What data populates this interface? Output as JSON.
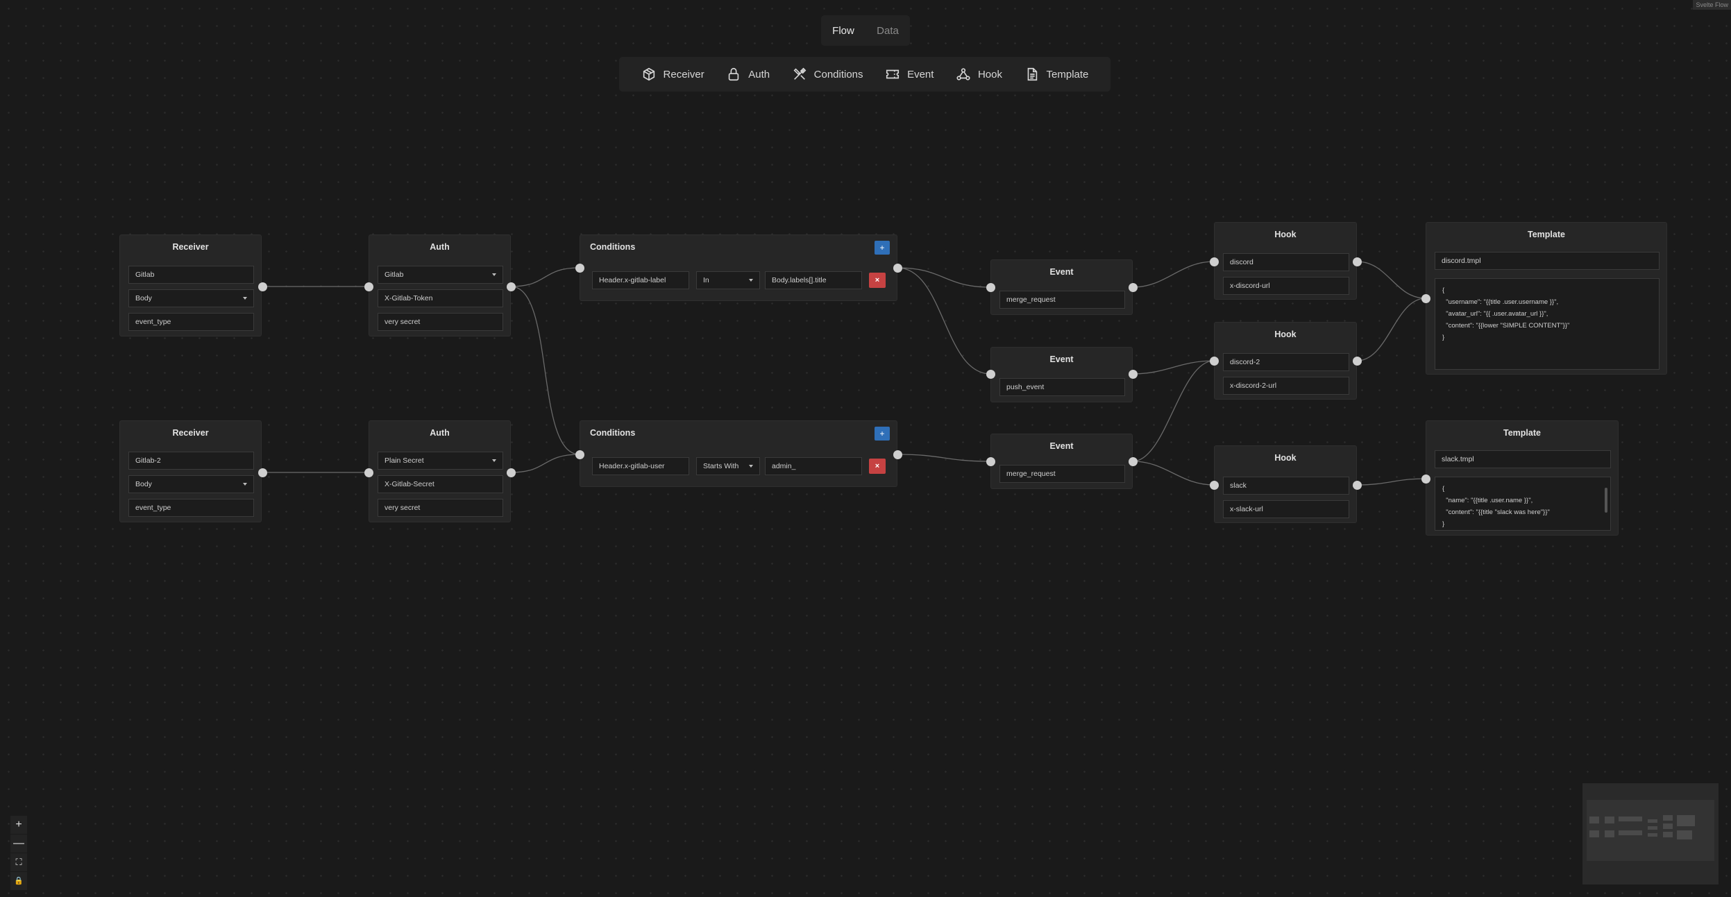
{
  "view_tabs": [
    {
      "label": "Flow"
    },
    {
      "label": "Data"
    }
  ],
  "toolbar": [
    {
      "label": "Receiver",
      "icon": "box-icon"
    },
    {
      "label": "Auth",
      "icon": "lock-icon"
    },
    {
      "label": "Conditions",
      "icon": "tools-icon"
    },
    {
      "label": "Event",
      "icon": "ticket-icon"
    },
    {
      "label": "Hook",
      "icon": "webhook-icon"
    },
    {
      "label": "Template",
      "icon": "document-icon"
    }
  ],
  "receivers": [
    {
      "title": "Receiver",
      "name": "Gitlab",
      "source": "Body",
      "field": "event_type"
    },
    {
      "title": "Receiver",
      "name": "Gitlab-2",
      "source": "Body",
      "field": "event_type"
    }
  ],
  "auths": [
    {
      "title": "Auth",
      "type": "Gitlab",
      "header": "X-Gitlab-Token",
      "secret": "very secret"
    },
    {
      "title": "Auth",
      "type": "Plain Secret",
      "header": "X-Gitlab-Secret",
      "secret": "very secret"
    }
  ],
  "conditions": [
    {
      "title": "Conditions",
      "add_label": "+",
      "rows": [
        {
          "left": "Header.x-gitlab-label",
          "op": "In",
          "right": "Body.labels[].title",
          "delete_label": "×"
        }
      ]
    },
    {
      "title": "Conditions",
      "add_label": "+",
      "rows": [
        {
          "left": "Header.x-gitlab-user",
          "op": "Starts With",
          "right": "admin_",
          "delete_label": "×"
        }
      ]
    }
  ],
  "events": [
    {
      "title": "Event",
      "value": "merge_request"
    },
    {
      "title": "Event",
      "value": "push_event"
    },
    {
      "title": "Event",
      "value": "merge_request"
    }
  ],
  "hooks": [
    {
      "title": "Hook",
      "name": "discord",
      "url": "x-discord-url"
    },
    {
      "title": "Hook",
      "name": "discord-2",
      "url": "x-discord-2-url"
    },
    {
      "title": "Hook",
      "name": "slack",
      "url": "x-slack-url"
    }
  ],
  "templates": [
    {
      "title": "Template",
      "file": "discord.tmpl",
      "body": "{\n  \"username\": \"{{title .user.username }}\",\n  \"avatar_url\": \"{{ .user.avatar_url }}\",\n  \"content\": \"{{lower \"SIMPLE CONTENT\"}}\"\n}"
    },
    {
      "title": "Template",
      "file": "slack.tmpl",
      "body": "{\n  \"name\": \"{{title .user.name }}\",\n  \"content\": \"{{title \"slack was here\"}}\"\n}"
    }
  ],
  "zoom_controls": [
    {
      "label": "+"
    },
    {
      "label": "—"
    },
    {
      "label": "⛶"
    },
    {
      "label": "🔒"
    }
  ],
  "attribution": "Svelte Flow"
}
